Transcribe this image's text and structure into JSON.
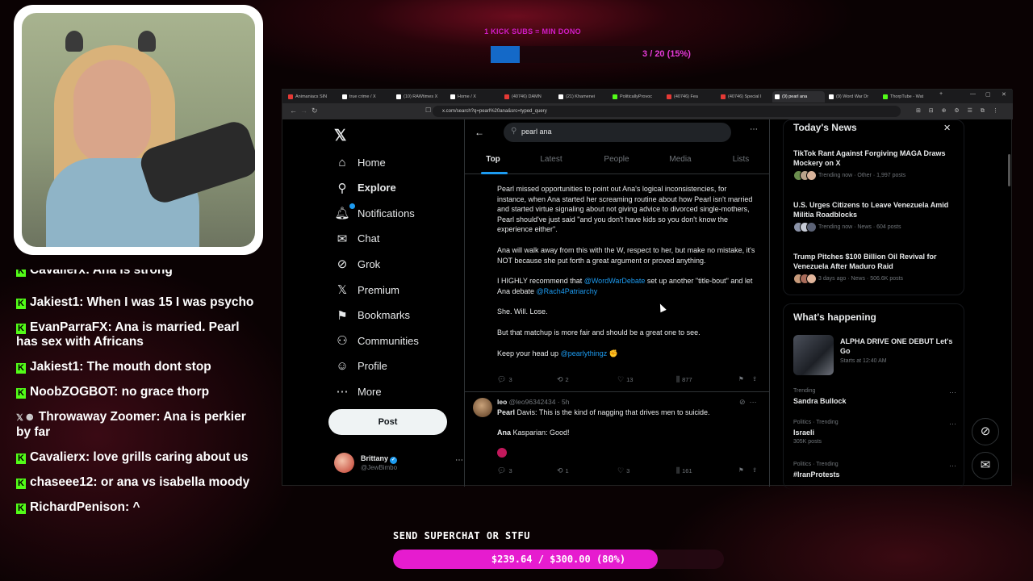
{
  "stream": {
    "kick_goal_label": "1 KICK SUBS = MIN DONO",
    "sub_goal": {
      "text": "3 / 20 (15%)",
      "progress": 0.15,
      "fill_color": "#1469c8"
    },
    "superchat": {
      "label": "SEND SUPERCHAT OR STFU",
      "text": "$239.64 / $300.00 (80%)",
      "progress": 0.8,
      "fill_color": "#e61ccf"
    },
    "chat_partial": "Cavalierx: Ana is strong",
    "chat": [
      {
        "badge": "kick-icon",
        "text": "Jakiest1: When I was 15 I was psycho"
      },
      {
        "badge": "kick-icon",
        "text": "EvanParraFX: Ana is married. Pearl has sex with Africans"
      },
      {
        "badge": "kick-icon",
        "text": "Jakiest1: The mouth dont stop"
      },
      {
        "badge": "kick-icon",
        "text": "NoobZOGBOT: no grace thorp"
      },
      {
        "badge": "x-icon",
        "text": "Throwaway Zoomer: Ana is perkier by far"
      },
      {
        "badge": "kick-icon",
        "text": "Cavalierx: love grills caring about us"
      },
      {
        "badge": "kick-icon",
        "text": "chaseee12: or ana vs isabella moody"
      },
      {
        "badge": "kick-icon",
        "text": "RichardPenison: ^"
      }
    ],
    "kick_color": "#53fc18"
  },
  "browser": {
    "tabs": [
      {
        "label": "Animaniacs SIN",
        "color": "#e53935"
      },
      {
        "label": "true crime / X",
        "color": "#ffffff"
      },
      {
        "label": "(10) RAWtimes X",
        "color": "#ffffff"
      },
      {
        "label": "Home / X",
        "color": "#ffffff"
      },
      {
        "label": "(40746) DAMN",
        "color": "#e53935"
      },
      {
        "label": "(21) Khamenei",
        "color": "#ffffff"
      },
      {
        "label": "PoliticallyProvoc",
        "color": "#53fc18"
      },
      {
        "label": "(40746) Fea",
        "color": "#e53935"
      },
      {
        "label": "(40746) Special I",
        "color": "#e53935"
      },
      {
        "label": "(9) pearl ana",
        "color": "#ffffff",
        "active": true
      },
      {
        "label": "(9) Word War Dr",
        "color": "#ffffff"
      },
      {
        "label": "ThorpTube - Wat",
        "color": "#53fc18"
      }
    ],
    "url": "x.com/search?q=pearl%20ana&src=typed_query"
  },
  "x": {
    "nav": [
      {
        "icon": "home-icon",
        "glyph": "⌂",
        "label": "Home",
        "bold": false
      },
      {
        "icon": "search-icon",
        "glyph": "⚲",
        "label": "Explore",
        "bold": true
      },
      {
        "icon": "bell-icon",
        "glyph": "🔔︎",
        "label": "Notifications",
        "bold": false
      },
      {
        "icon": "chat-icon",
        "glyph": "✉",
        "label": "Chat",
        "bold": false
      },
      {
        "icon": "grok-icon",
        "glyph": "⊘",
        "label": "Grok",
        "bold": false
      },
      {
        "icon": "x-premium-icon",
        "glyph": "𝕏",
        "label": "Premium",
        "bold": false
      },
      {
        "icon": "bookmark-icon",
        "glyph": "⚑",
        "label": "Bookmarks",
        "bold": false
      },
      {
        "icon": "communities-icon",
        "glyph": "⚇",
        "label": "Communities",
        "bold": false
      },
      {
        "icon": "profile-icon",
        "glyph": "☺",
        "label": "Profile",
        "bold": false
      },
      {
        "icon": "more-icon",
        "glyph": "⋯",
        "label": "More",
        "bold": false
      }
    ],
    "post_label": "Post",
    "profile": {
      "name": "Brittany",
      "handle": "@JewBimbo"
    },
    "search_value": "pearl ana",
    "tabs": [
      "Top",
      "Latest",
      "People",
      "Media",
      "Lists"
    ],
    "tweet1": {
      "paragraphs": [
        "Pearl missed opportunities to point out Ana's logical inconsistencies, for instance, when Ana started her screaming routine about how Pearl isn't married and started virtue signaling about not giving advice to divorced single-mothers, Pearl should've just said \"and you don't have kids so you don't know the experience either\".",
        "Ana will walk away from this with the W, respect to her, but make no mistake, it's NOT because she put forth a great argument or proved anything."
      ],
      "rec_pre": "I HIGHLY recommend that ",
      "mention1": "@WordWarDebate",
      "rec_mid": " set up another \"title-bout\" and let Ana debate ",
      "mention2": "@Rach4Patriarchy",
      "p4": "She. Will. Lose.",
      "p5": "But that matchup is more fair and should be a great one to see.",
      "p6_pre": "Keep your head up ",
      "mention3": "@pearlythingz",
      "stats": {
        "replies": "3",
        "reposts": "2",
        "likes": "13",
        "views": "877"
      }
    },
    "tweet2": {
      "name": "leo",
      "handle": "@leo96342434 · 5h",
      "line1_name": "Pearl",
      "line1_text": " Davis: This is the kind of nagging that drives men to suicide.",
      "line2_name": "Ana",
      "line2_text": " Kasparian: Good!",
      "stats": {
        "replies": "3",
        "reposts": "1",
        "likes": "3",
        "views": "161"
      }
    },
    "news": {
      "title": "Today's News",
      "items": [
        {
          "title": "TikTok Rant Against Forgiving MAGA Draws Mockery on X",
          "meta": "Trending now · Other · 1,997 posts"
        },
        {
          "title": "U.S. Urges Citizens to Leave Venezuela Amid Militia Roadblocks",
          "meta": "Trending now · News · 604 posts"
        },
        {
          "title": "Trump Pitches $100 Billion Oil Revival for Venezuela After Maduro Raid",
          "meta": "3 days ago · News · 506.6K posts"
        }
      ]
    },
    "happening": {
      "title": "What's happening",
      "event_title": "ALPHA DRIVE ONE DEBUT Let's Go",
      "event_time": "Starts at 12:40 AM",
      "trends": [
        {
          "meta": "Trending",
          "name": "Sandra Bullock",
          "count": ""
        },
        {
          "meta": "Politics · Trending",
          "name": "Israeli",
          "count": "305K posts"
        },
        {
          "meta": "Politics · Trending",
          "name": "#IranProtests",
          "count": ""
        }
      ]
    }
  }
}
